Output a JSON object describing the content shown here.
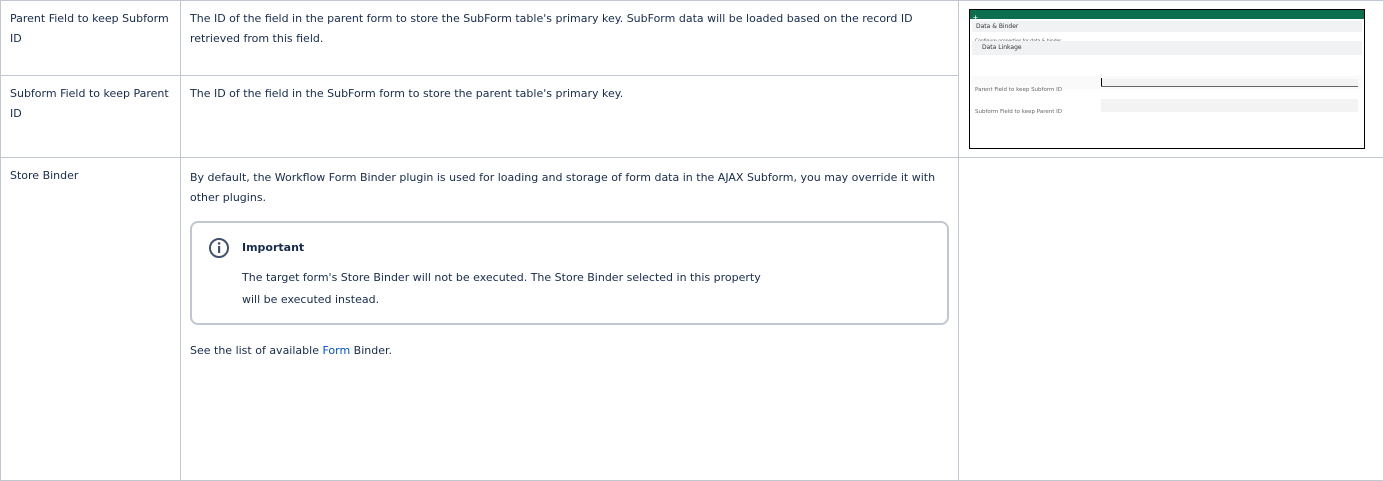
{
  "rows": [
    {
      "name": "Parent Field to keep Subform ID",
      "description": "The ID of the field in the parent form to store the SubForm table's primary key. SubForm data will be loaded based on the record ID retrieved from this field."
    },
    {
      "name": "Subform Field to keep Parent ID",
      "description": "The ID of the field in the SubForm form to store the parent table's primary key."
    },
    {
      "name": "Store Binder",
      "description": "By default, the Workflow Form Binder plugin is used for loading and storage of form data in the AJAX Subform, you may override it with other plugins.",
      "note": {
        "icon": "info-icon",
        "title": "Important",
        "body": "The target form's Store Binder will not be executed. The Store Binder selected in this property will be executed instead."
      },
      "see_prefix": "See the list of available ",
      "see_link": "Form",
      "see_suffix": " Binder."
    }
  ],
  "screenshot": {
    "header_icon": "plus-icon",
    "section_title": "Data & Binder",
    "section_desc": "Configure properties for data & binder",
    "subsection_title": "Data Linkage",
    "field1_label": "Parent Field to keep Subform ID",
    "field2_label": "Subform Field to keep Parent ID"
  },
  "colors": {
    "border": "#c1c7d0",
    "link": "#0052cc",
    "header_bar": "#0b6e4f",
    "text": "#172b4d"
  }
}
